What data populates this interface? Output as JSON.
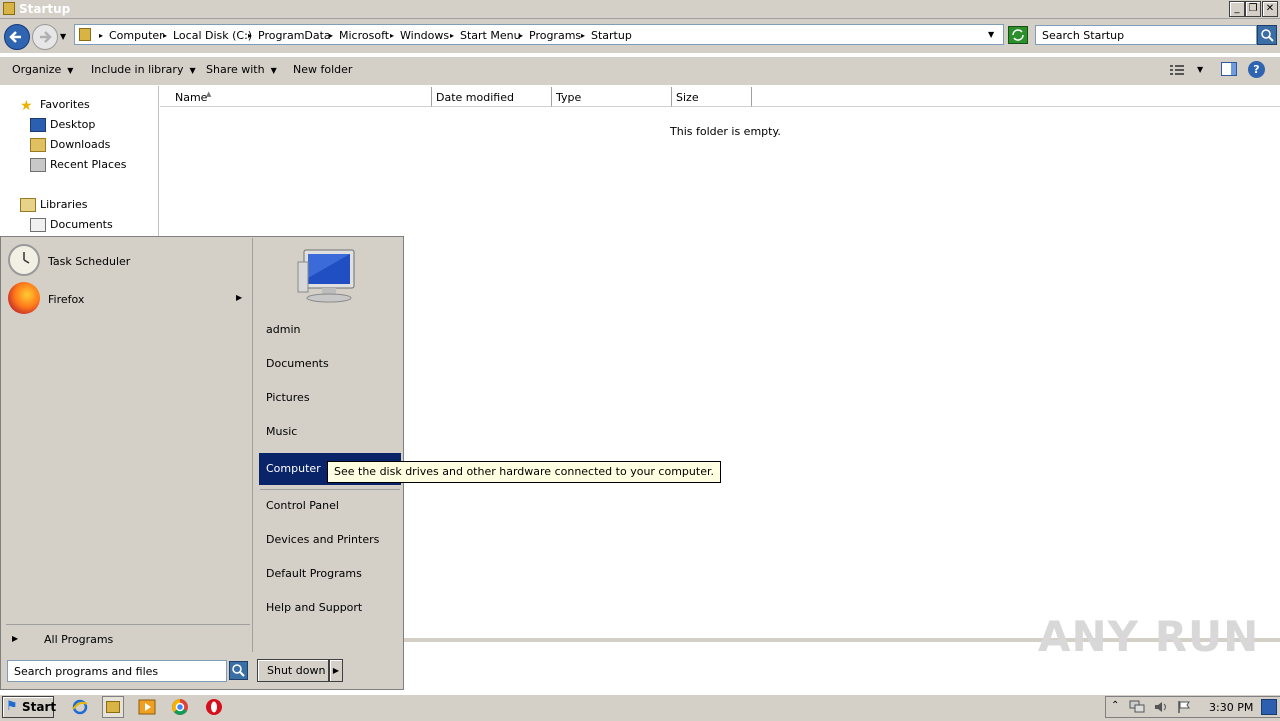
{
  "window": {
    "title": "Startup",
    "minimize_label": "_",
    "maximize_label": "❐",
    "close_label": "✕"
  },
  "address": {
    "breadcrumbs": [
      "Computer",
      "Local Disk (C:)",
      "ProgramData",
      "Microsoft",
      "Windows",
      "Start Menu",
      "Programs",
      "Startup"
    ],
    "separator": "▸"
  },
  "search": {
    "placeholder": "Search Startup"
  },
  "toolbar": {
    "organize": "Organize",
    "include_in_library": "Include in library",
    "share_with": "Share with",
    "new_folder": "New folder",
    "help": "?"
  },
  "navpane": {
    "favorites_label": "Favorites",
    "desktop": "Desktop",
    "downloads": "Downloads",
    "recent_places": "Recent Places",
    "libraries_label": "Libraries",
    "documents": "Documents"
  },
  "columns": {
    "name": "Name",
    "date_modified": "Date modified",
    "type": "Type",
    "size": "Size"
  },
  "content": {
    "empty_message": "This folder is empty."
  },
  "start_menu": {
    "programs": [
      {
        "label": "Task Scheduler",
        "icon": "clock-icon"
      },
      {
        "label": "Firefox",
        "icon": "firefox-icon",
        "has_submenu": true
      }
    ],
    "all_programs": "All Programs",
    "search_placeholder": "Search programs and files",
    "right_items": {
      "user": "admin",
      "documents": "Documents",
      "pictures": "Pictures",
      "music": "Music",
      "computer": "Computer",
      "control_panel": "Control Panel",
      "devices_printers": "Devices and Printers",
      "default_programs": "Default Programs",
      "help_support": "Help and Support"
    },
    "shutdown": "Shut down",
    "tooltip": "See the disk drives and other hardware connected to your computer."
  },
  "taskbar": {
    "start": "Start",
    "clock": "3:30 PM",
    "pinned": [
      "internet-explorer-icon",
      "explorer-icon",
      "media-player-icon",
      "chrome-icon",
      "opera-icon"
    ]
  },
  "watermark": "ANY RUN",
  "colors": {
    "highlight": "#0a246a",
    "tooltip_bg": "#ffffe1",
    "chrome": "#d4d0c8"
  }
}
